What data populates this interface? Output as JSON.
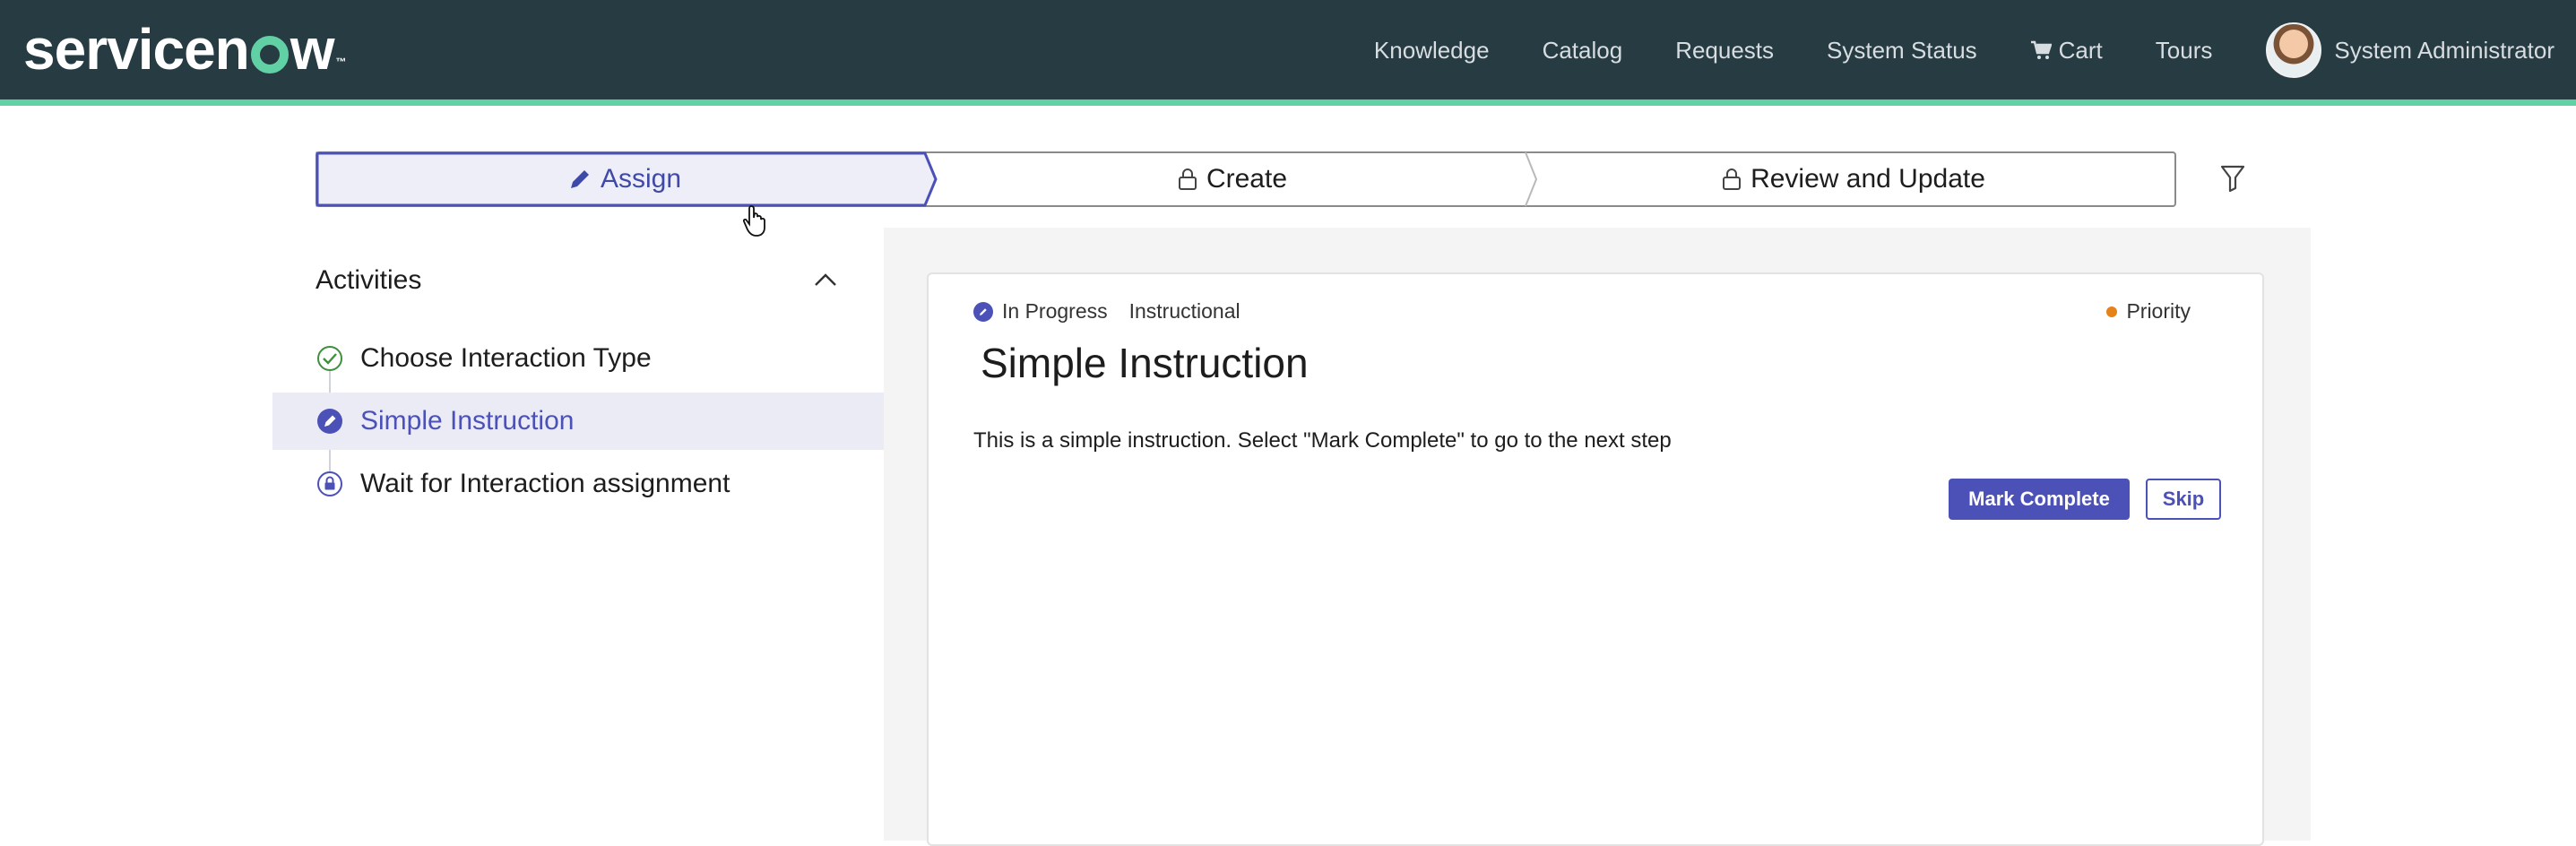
{
  "header": {
    "logo_text": "servicenow",
    "nav": [
      "Knowledge",
      "Catalog",
      "Requests",
      "System Status",
      "Cart",
      "Tours"
    ],
    "user_name": "System Administrator",
    "colors": {
      "background": "#263b42",
      "accent": "#62d0a5"
    }
  },
  "stages": [
    {
      "label": "Assign",
      "icon": "pencil-icon",
      "active": true
    },
    {
      "label": "Create",
      "icon": "lock-icon",
      "active": false
    },
    {
      "label": "Review and Update",
      "icon": "lock-icon",
      "active": false
    }
  ],
  "activities": {
    "title": "Activities",
    "items": [
      {
        "label": "Choose Interaction Type",
        "state": "complete",
        "icon": "check-circle-icon"
      },
      {
        "label": "Simple Instruction",
        "state": "in-progress",
        "icon": "in-progress-icon"
      },
      {
        "label": "Wait for Interaction assignment",
        "state": "locked",
        "icon": "lock-circle-icon"
      }
    ]
  },
  "card": {
    "status": "In Progress",
    "type": "Instructional",
    "priority": "Priority",
    "title": "Simple Instruction",
    "description": "This is a simple instruction. Select \"Mark Complete\" to go to the next step",
    "buttons": {
      "complete": "Mark Complete",
      "skip": "Skip"
    }
  },
  "colors": {
    "primary": "#4c51b8",
    "priority": "#e5821a"
  }
}
